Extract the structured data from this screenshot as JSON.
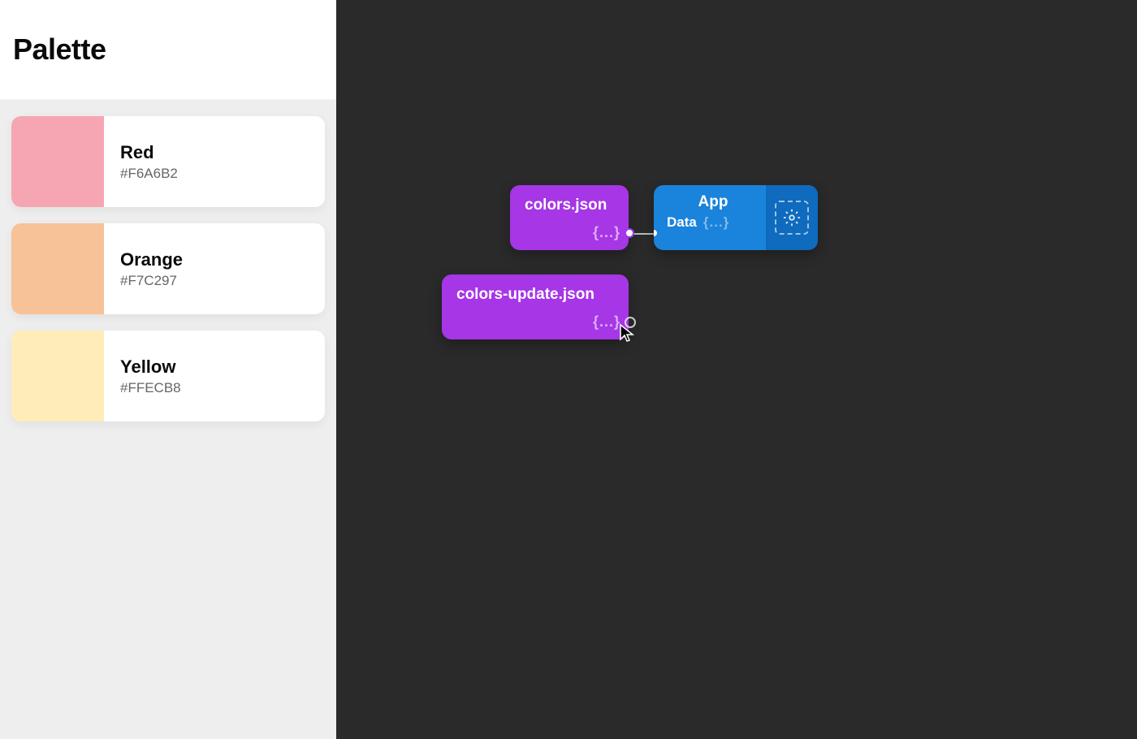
{
  "sidebar": {
    "title": "Palette",
    "items": [
      {
        "name": "Red",
        "hex": "#F6A6B2",
        "swatch": "#F6A6B2"
      },
      {
        "name": "Orange",
        "hex": "#F7C297",
        "swatch": "#F7C297"
      },
      {
        "name": "Yellow",
        "hex": "#FFECB8",
        "swatch": "#FFECB8"
      }
    ]
  },
  "canvas": {
    "nodes": {
      "colors_json": {
        "title": "colors.json",
        "output_glyph": "{...}"
      },
      "colors_update_json": {
        "title": "colors-update.json",
        "output_glyph": "{...}"
      },
      "app": {
        "title": "App",
        "data_label": "Data",
        "data_glyph": "{...}"
      }
    }
  },
  "colors": {
    "node_purple": "#a636e6",
    "node_blue": "#1a83db",
    "node_blue_dark": "#0e6bbd",
    "canvas_bg": "#2a2a2a"
  }
}
